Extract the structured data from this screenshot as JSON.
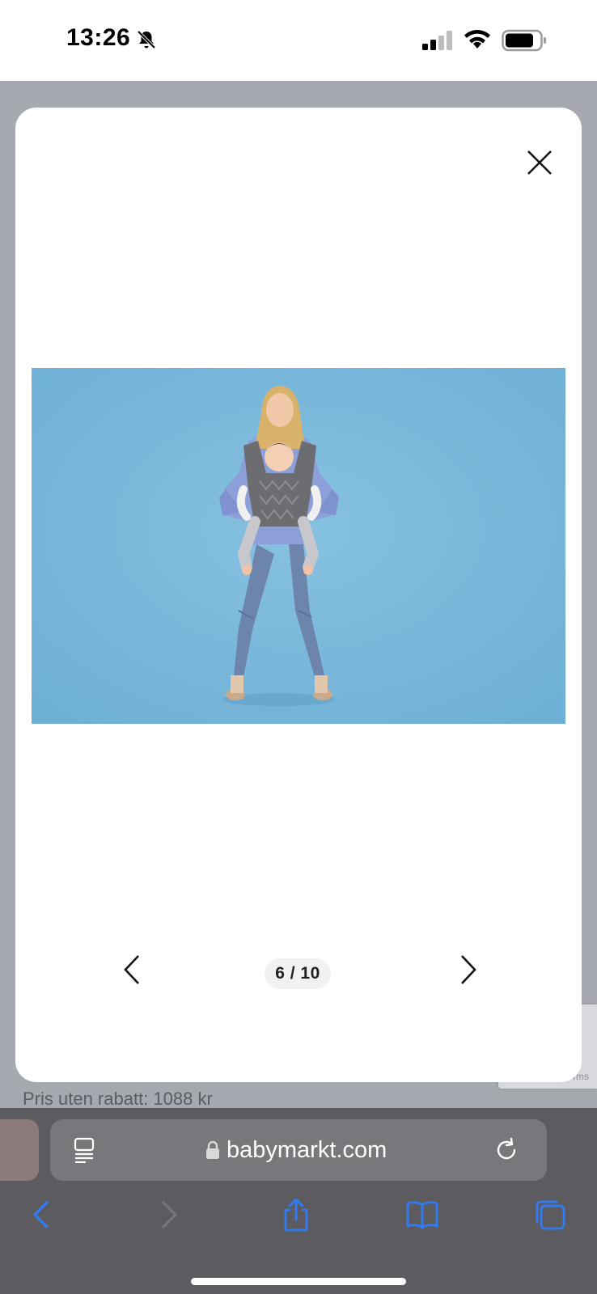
{
  "status_bar": {
    "time": "13:26",
    "icons": [
      "bell-slash-icon",
      "cellular-signal-icon",
      "wifi-icon",
      "battery-icon"
    ]
  },
  "background_page": {
    "price_text": "Pris uten rabatt: 1088 kr",
    "recaptcha_text": "rms"
  },
  "gallery_modal": {
    "close_icon": "close-icon",
    "image_alt": "Woman wearing a grey baby carrier with a baby, on blue background",
    "counter": "6 / 10",
    "prev_icon": "chevron-left-icon",
    "next_icon": "chevron-right-icon"
  },
  "browser": {
    "url": "babymarkt.com",
    "toolbar_icons": [
      "back-icon",
      "forward-icon",
      "share-icon",
      "bookmarks-icon",
      "tabs-icon"
    ],
    "accent_color": "#2f7cf6"
  }
}
